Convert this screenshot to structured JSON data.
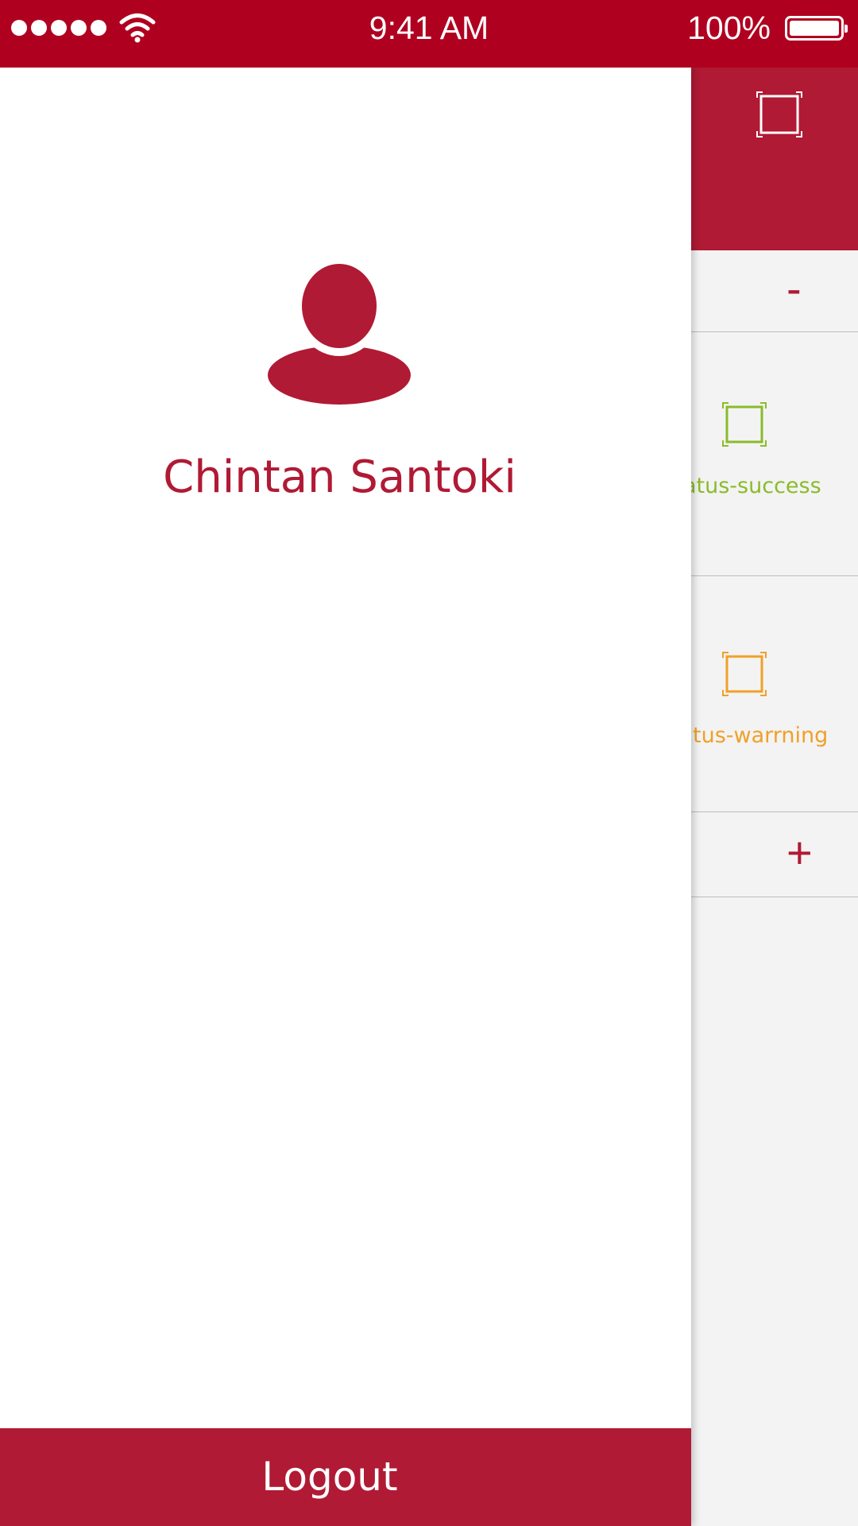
{
  "status_bar": {
    "time": "9:41 AM",
    "battery_percent": "100%",
    "signal_bars": 5,
    "wifi_icon": "wifi-icon",
    "battery_icon": "battery-icon"
  },
  "main": {
    "header_icon": "scan-frame-icon",
    "stepper": {
      "minus_label": "-",
      "plus_label": "+"
    },
    "statuses": [
      {
        "label": "atus-success",
        "icon": "scan-frame-icon",
        "color": "#8bbb2a"
      },
      {
        "label": "tus-warrning",
        "icon": "scan-frame-icon",
        "color": "#f0a028"
      }
    ]
  },
  "drawer": {
    "avatar_icon": "user-avatar-icon",
    "user_name": "Chintan Santoki",
    "logout_label": "Logout"
  },
  "colors": {
    "status_bar": "#b00020",
    "brand": "#b01a34",
    "success": "#8bbb2a",
    "warning": "#f0a028"
  }
}
